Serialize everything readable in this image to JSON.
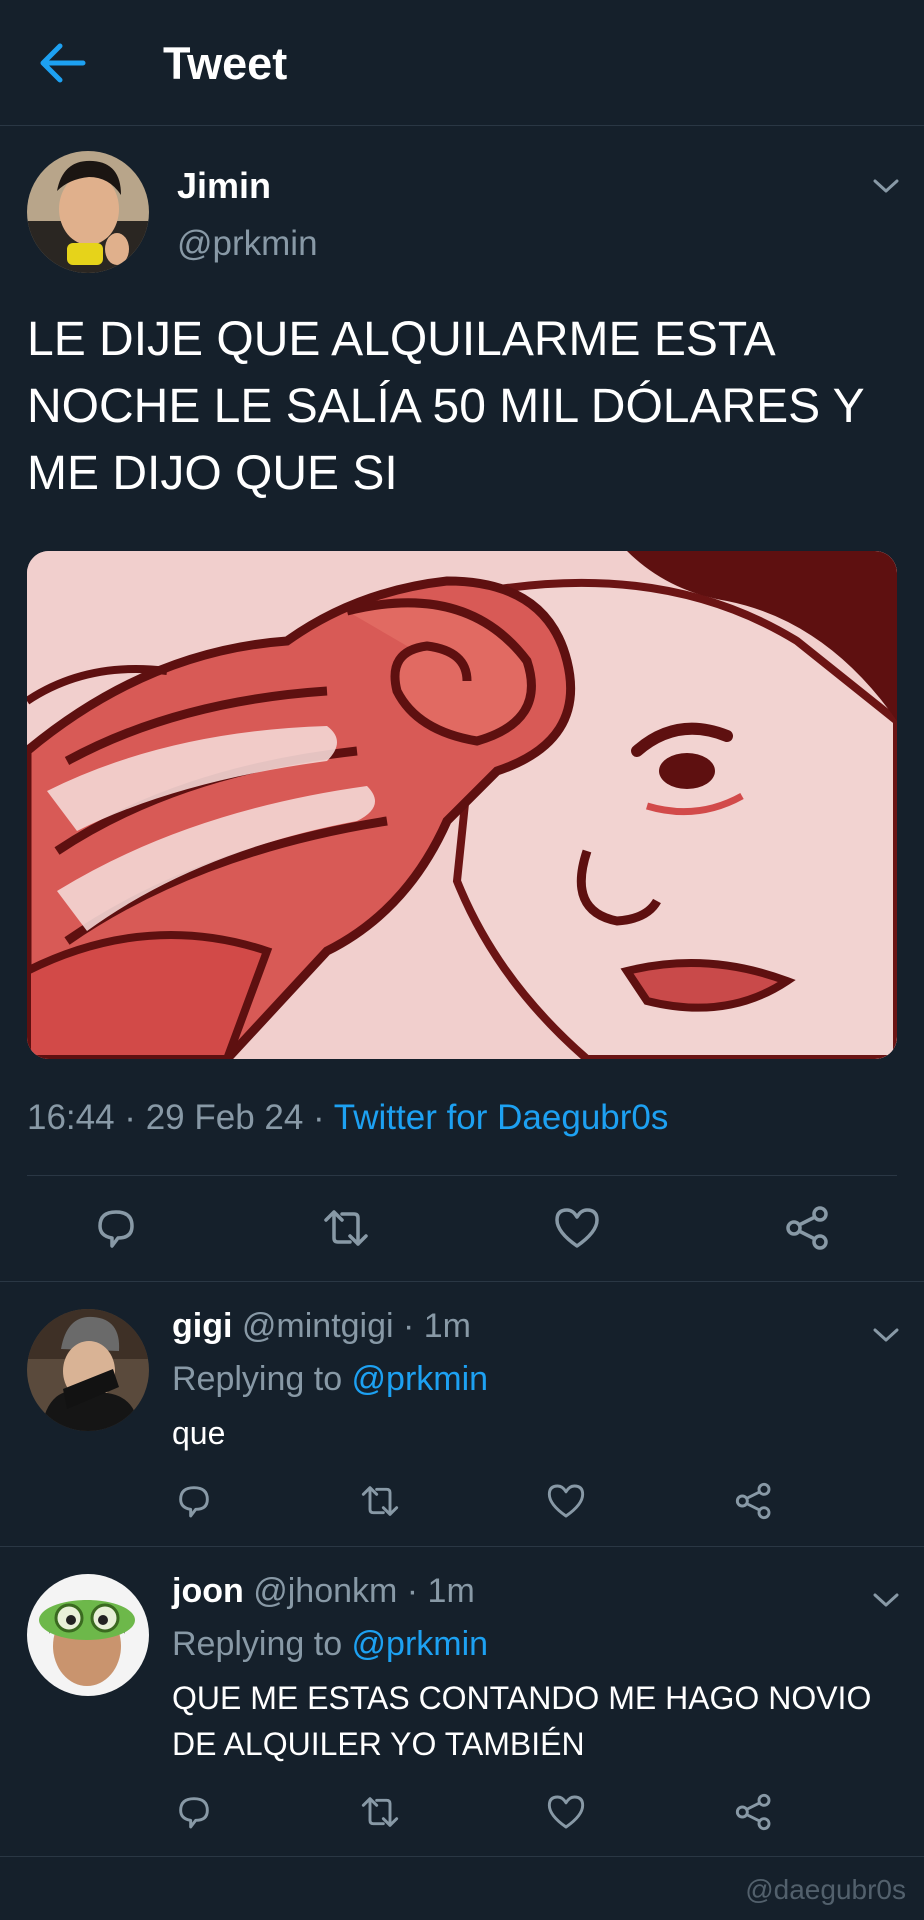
{
  "header": {
    "title": "Tweet",
    "back_icon": "arrow-left-icon"
  },
  "tweet": {
    "author_name": "Jimin",
    "author_handle": "@prkmin",
    "text": "LE DIJE QUE ALQUILARME ESTA NOCHE LE SALÍA 50 MIL DÓLARES Y ME DIJO QUE SI",
    "time": "16:44 · 29 Feb 24 · ",
    "source": "Twitter for Daegubr0s",
    "actions": [
      "reply-icon",
      "retweet-icon",
      "like-icon",
      "share-icon"
    ]
  },
  "replies": [
    {
      "name": "gigi",
      "handle": "@mintgigi · 1m",
      "replying_label": "Replying to ",
      "mention": "@prkmin",
      "text": "que"
    },
    {
      "name": "joon",
      "handle": "@jhonkm · 1m",
      "replying_label": "Replying to ",
      "mention": "@prkmin",
      "text": "QUE ME ESTAS CONTANDO ME HAGO NOVIO DE ALQUILER YO TAMBIÉN"
    }
  ],
  "watermark": "@daegubr0s",
  "colors": {
    "background": "#15202b",
    "accent": "#1da1f2",
    "muted": "#8899a6",
    "divider": "#2a3744"
  }
}
